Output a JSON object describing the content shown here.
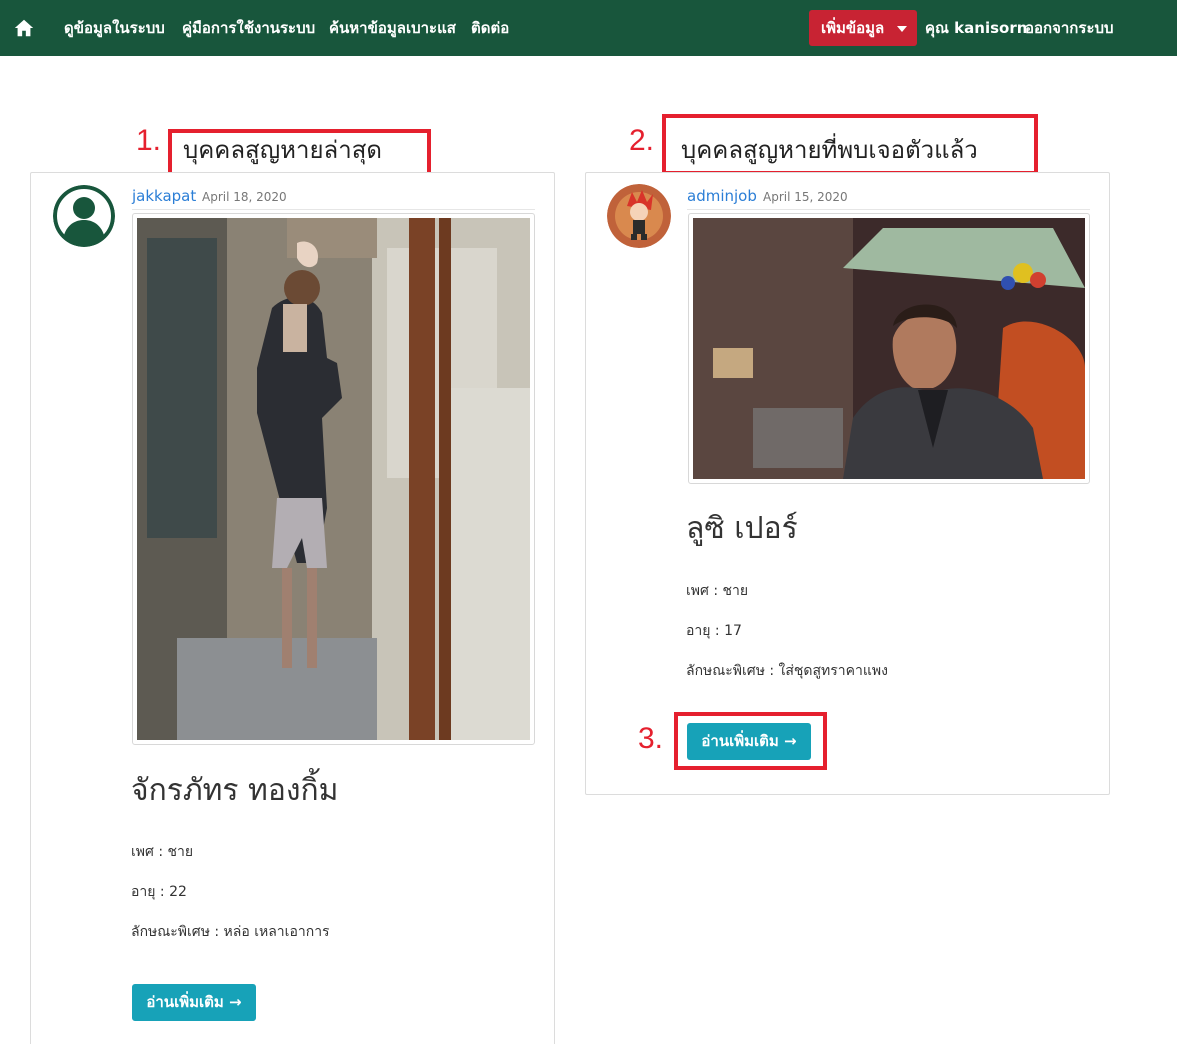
{
  "navbar": {
    "home_icon": "home-icon",
    "links": [
      "ดูข้อมูลในระบบ",
      "คู่มือการใช้งานระบบ",
      "ค้นหาข้อมูลเบาะแส",
      "ติดต่อ"
    ],
    "add_button": "เพิ่มข้อมูล",
    "user": "คุณ kanisorn",
    "logout": "ออกจากระบบ",
    "bg_color": "#18563c",
    "add_color": "#c82333"
  },
  "annotations": {
    "one": "1.",
    "two": "2.",
    "three": "3.",
    "color": "#e5202e"
  },
  "sections": {
    "latest_title": "บุคคลสูญหายล่าสุด",
    "found_title": "บุคคลสูญหายที่พบเจอตัวแล้ว"
  },
  "latest_post": {
    "author": "jakkapat",
    "date": "April 18, 2020",
    "avatar_icon": "user-circle-icon",
    "name": "จักรภัทร ทองกิ้ม",
    "gender": "เพศ : ชาย",
    "age": "อายุ : 22",
    "features": "ลักษณะพิเศษ : หล่อ เหลาเอาการ",
    "read_more": "อ่านเพิ่มเติม →"
  },
  "found_post": {
    "author": "adminjob",
    "date": "April 15, 2020",
    "name": "ลูซิ เปอร์",
    "gender": "เพศ : ชาย",
    "age": "อายุ : 17",
    "features": "ลักษณะพิเศษ : ใส่ชุดสูทราคาแพง",
    "read_more": "อ่านเพิ่มเติม →"
  }
}
